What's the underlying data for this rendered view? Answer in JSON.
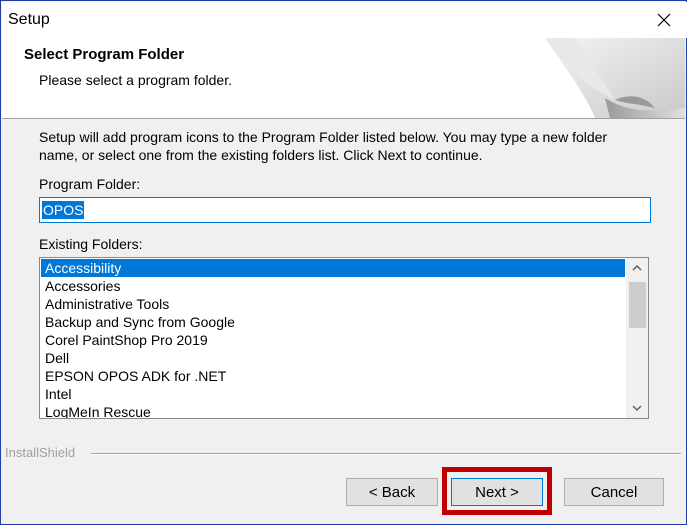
{
  "window": {
    "title": "Setup"
  },
  "header": {
    "title": "Select Program Folder",
    "subtitle": "Please select a program folder."
  },
  "instructions": "Setup will add program icons to the Program Folder listed below.  You may type a new folder name, or select one from the existing folders list.  Click Next to continue.",
  "program_folder": {
    "label": "Program Folder:",
    "value": "OPOS"
  },
  "existing_folders": {
    "label": "Existing Folders:",
    "items": [
      "Accessibility",
      "Accessories",
      "Administrative Tools",
      "Backup and Sync from Google",
      "Corel PaintShop Pro 2019",
      "Dell",
      "EPSON OPOS ADK for .NET",
      "Intel",
      "LogMeIn Rescue"
    ],
    "selected": "Accessibility"
  },
  "branding": "InstallShield",
  "buttons": {
    "back": "< Back",
    "next": "Next >",
    "cancel": "Cancel"
  },
  "colors": {
    "selection": "#0078d7",
    "highlight_box": "#c00000",
    "window_border": "#1f3fa6"
  },
  "icons": {
    "close": "close-icon",
    "scroll_up": "chevron-up-icon",
    "scroll_down": "chevron-down-icon"
  }
}
